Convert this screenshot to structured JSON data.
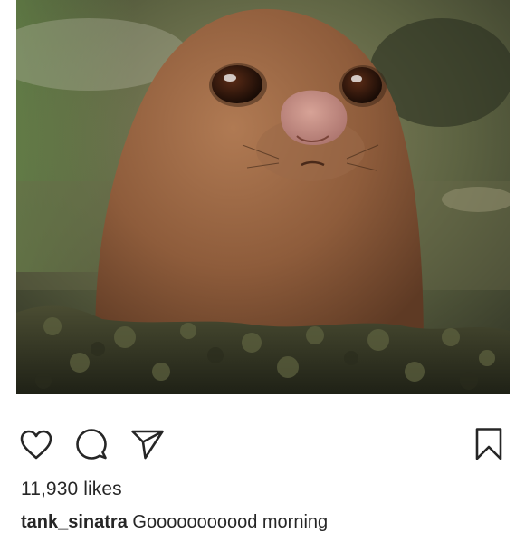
{
  "post": {
    "image": {
      "alt_subject": "mole-like creature peeking out of soil"
    },
    "actions": {
      "like_icon": "heart-icon",
      "comment_icon": "comment-icon",
      "share_icon": "paper-plane-icon",
      "save_icon": "bookmark-icon"
    },
    "likes_text": "11,930 likes",
    "caption": {
      "username": "tank_sinatra",
      "text": "Gooooooooood morning"
    }
  },
  "colors": {
    "text": "#262626",
    "background": "#ffffff"
  }
}
